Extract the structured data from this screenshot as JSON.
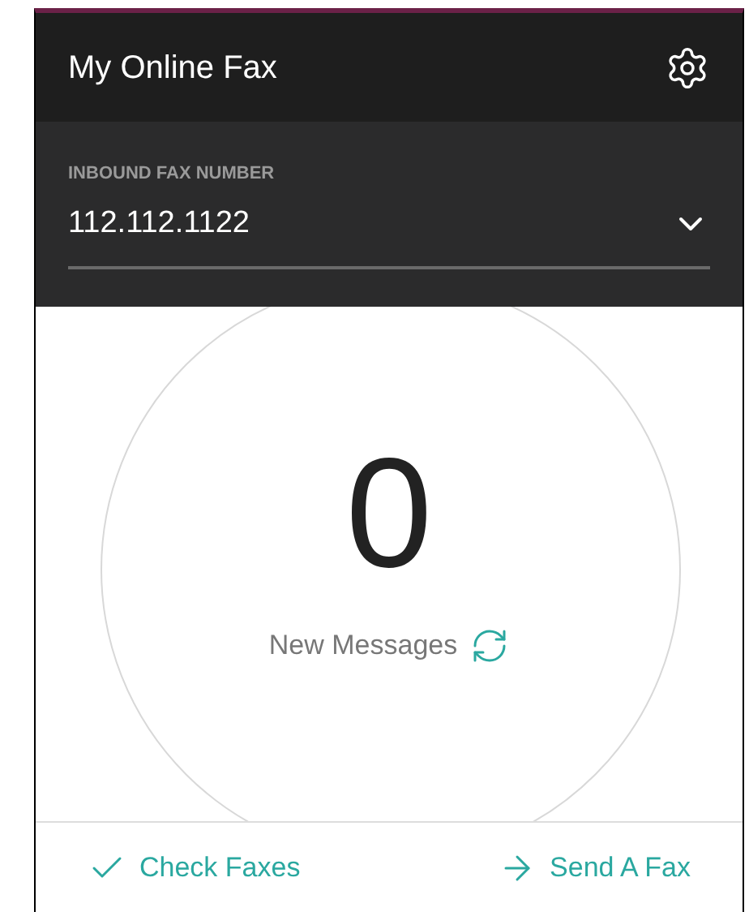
{
  "header": {
    "title": "My Online Fax"
  },
  "fax_number": {
    "label": "INBOUND FAX NUMBER",
    "value": "112.112.1122"
  },
  "messages": {
    "count": "0",
    "label": "New Messages"
  },
  "actions": [
    {
      "kind": "check",
      "label": "Check Faxes"
    },
    {
      "kind": "send",
      "label": "Send A Fax"
    }
  ]
}
